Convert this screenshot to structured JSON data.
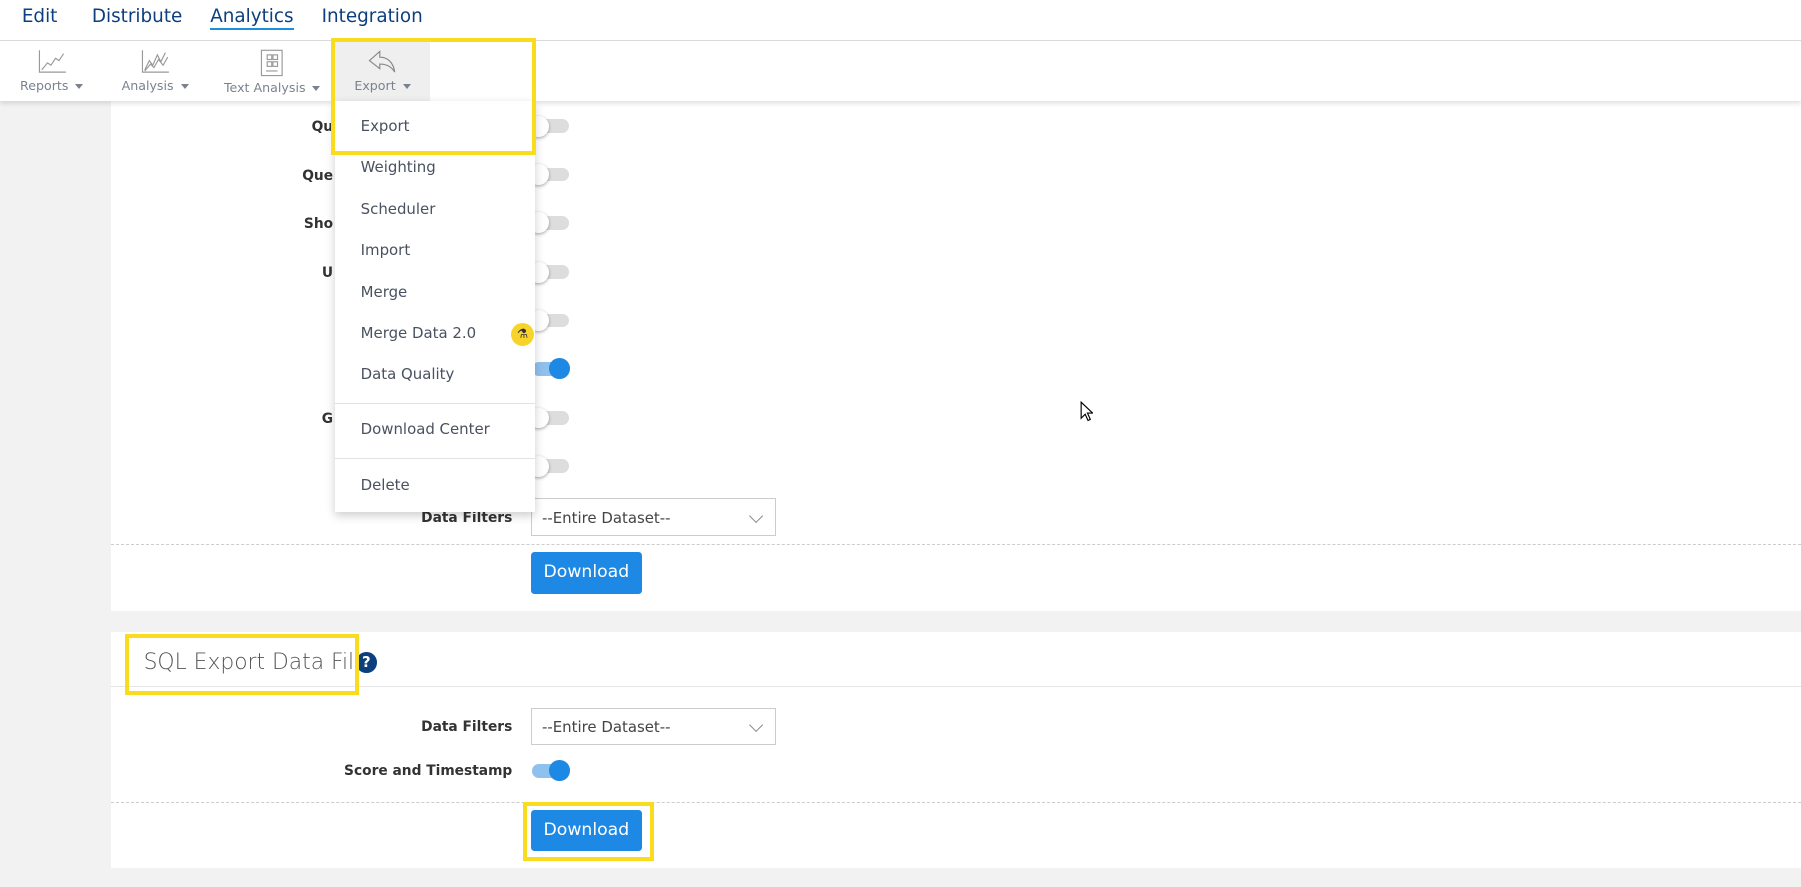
{
  "nav": {
    "tabs": [
      "Edit",
      "Distribute",
      "Analytics",
      "Integration"
    ],
    "active": "Analytics"
  },
  "toolbar": {
    "reports": "Reports",
    "analysis": "Analysis",
    "text_analysis": "Text Analysis",
    "export": "Export"
  },
  "menu": {
    "items": [
      "Export",
      "Weighting",
      "Scheduler",
      "Import",
      "Merge",
      "Merge Data 2.0",
      "Data Quality",
      "Download Center",
      "Delete"
    ]
  },
  "section1": {
    "partial_labels": [
      "Qu",
      "Que",
      "Sho",
      "U",
      "",
      "",
      "G",
      ""
    ],
    "toggles": [
      false,
      false,
      false,
      false,
      false,
      true,
      false,
      false
    ],
    "data_filters_label": "Data Filters",
    "data_filters_value": "--Entire Dataset--",
    "download": "Download"
  },
  "section2": {
    "title": "SQL Export Data File",
    "data_filters_label": "Data Filters",
    "data_filters_value": "--Entire Dataset--",
    "score_label": "Score and Timestamp",
    "score_on": true,
    "download": "Download"
  },
  "colors": {
    "accent": "#1e88e5",
    "highlight": "#f8dc1d",
    "nav_text": "#0d3f7f"
  }
}
